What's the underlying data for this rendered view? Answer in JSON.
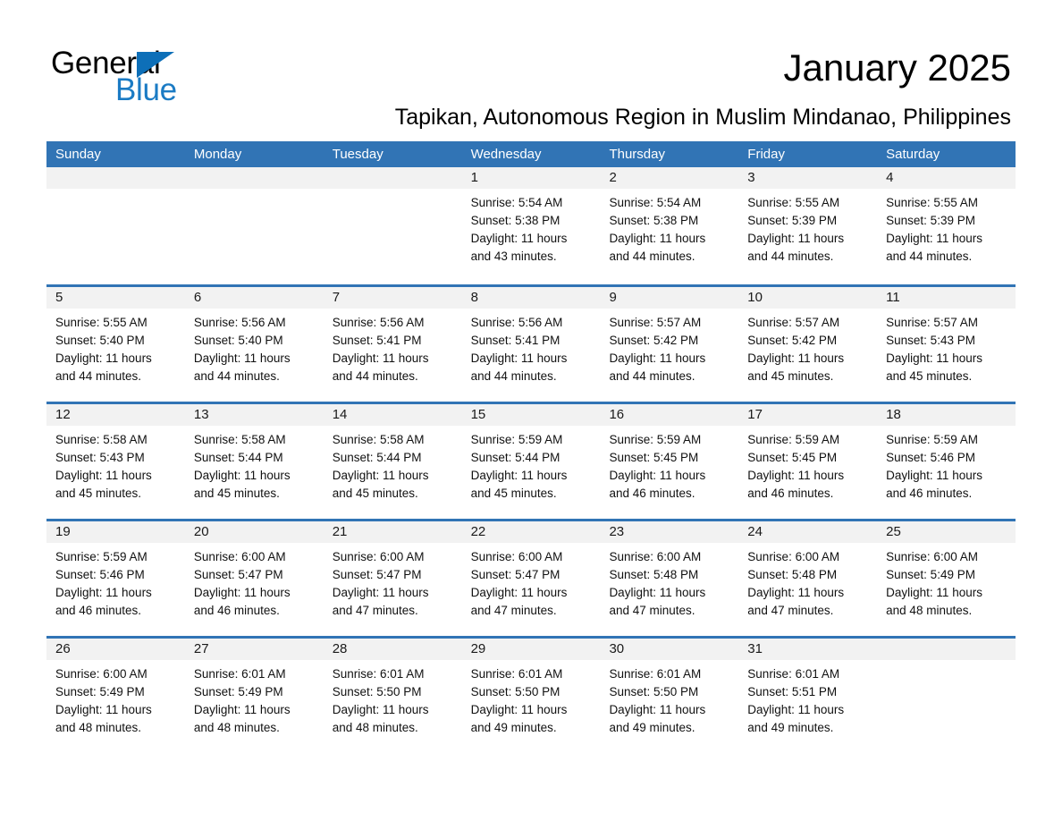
{
  "brand": {
    "name_top": "General",
    "name_bottom": "Blue",
    "triangle_color": "#0d6fb8",
    "blue_text_color": "#1b7bc4"
  },
  "header": {
    "month_title": "January 2025",
    "location": "Tapikan, Autonomous Region in Muslim Mindanao, Philippines",
    "header_bar_color": "#3174b5",
    "day_band_color": "#f2f2f2"
  },
  "weekdays": [
    "Sunday",
    "Monday",
    "Tuesday",
    "Wednesday",
    "Thursday",
    "Friday",
    "Saturday"
  ],
  "weeks": [
    [
      {
        "day": "",
        "sunrise": "",
        "sunset": "",
        "daylight_line1": "",
        "daylight_line2": ""
      },
      {
        "day": "",
        "sunrise": "",
        "sunset": "",
        "daylight_line1": "",
        "daylight_line2": ""
      },
      {
        "day": "",
        "sunrise": "",
        "sunset": "",
        "daylight_line1": "",
        "daylight_line2": ""
      },
      {
        "day": "1",
        "sunrise": "Sunrise: 5:54 AM",
        "sunset": "Sunset: 5:38 PM",
        "daylight_line1": "Daylight: 11 hours",
        "daylight_line2": "and 43 minutes."
      },
      {
        "day": "2",
        "sunrise": "Sunrise: 5:54 AM",
        "sunset": "Sunset: 5:38 PM",
        "daylight_line1": "Daylight: 11 hours",
        "daylight_line2": "and 44 minutes."
      },
      {
        "day": "3",
        "sunrise": "Sunrise: 5:55 AM",
        "sunset": "Sunset: 5:39 PM",
        "daylight_line1": "Daylight: 11 hours",
        "daylight_line2": "and 44 minutes."
      },
      {
        "day": "4",
        "sunrise": "Sunrise: 5:55 AM",
        "sunset": "Sunset: 5:39 PM",
        "daylight_line1": "Daylight: 11 hours",
        "daylight_line2": "and 44 minutes."
      }
    ],
    [
      {
        "day": "5",
        "sunrise": "Sunrise: 5:55 AM",
        "sunset": "Sunset: 5:40 PM",
        "daylight_line1": "Daylight: 11 hours",
        "daylight_line2": "and 44 minutes."
      },
      {
        "day": "6",
        "sunrise": "Sunrise: 5:56 AM",
        "sunset": "Sunset: 5:40 PM",
        "daylight_line1": "Daylight: 11 hours",
        "daylight_line2": "and 44 minutes."
      },
      {
        "day": "7",
        "sunrise": "Sunrise: 5:56 AM",
        "sunset": "Sunset: 5:41 PM",
        "daylight_line1": "Daylight: 11 hours",
        "daylight_line2": "and 44 minutes."
      },
      {
        "day": "8",
        "sunrise": "Sunrise: 5:56 AM",
        "sunset": "Sunset: 5:41 PM",
        "daylight_line1": "Daylight: 11 hours",
        "daylight_line2": "and 44 minutes."
      },
      {
        "day": "9",
        "sunrise": "Sunrise: 5:57 AM",
        "sunset": "Sunset: 5:42 PM",
        "daylight_line1": "Daylight: 11 hours",
        "daylight_line2": "and 44 minutes."
      },
      {
        "day": "10",
        "sunrise": "Sunrise: 5:57 AM",
        "sunset": "Sunset: 5:42 PM",
        "daylight_line1": "Daylight: 11 hours",
        "daylight_line2": "and 45 minutes."
      },
      {
        "day": "11",
        "sunrise": "Sunrise: 5:57 AM",
        "sunset": "Sunset: 5:43 PM",
        "daylight_line1": "Daylight: 11 hours",
        "daylight_line2": "and 45 minutes."
      }
    ],
    [
      {
        "day": "12",
        "sunrise": "Sunrise: 5:58 AM",
        "sunset": "Sunset: 5:43 PM",
        "daylight_line1": "Daylight: 11 hours",
        "daylight_line2": "and 45 minutes."
      },
      {
        "day": "13",
        "sunrise": "Sunrise: 5:58 AM",
        "sunset": "Sunset: 5:44 PM",
        "daylight_line1": "Daylight: 11 hours",
        "daylight_line2": "and 45 minutes."
      },
      {
        "day": "14",
        "sunrise": "Sunrise: 5:58 AM",
        "sunset": "Sunset: 5:44 PM",
        "daylight_line1": "Daylight: 11 hours",
        "daylight_line2": "and 45 minutes."
      },
      {
        "day": "15",
        "sunrise": "Sunrise: 5:59 AM",
        "sunset": "Sunset: 5:44 PM",
        "daylight_line1": "Daylight: 11 hours",
        "daylight_line2": "and 45 minutes."
      },
      {
        "day": "16",
        "sunrise": "Sunrise: 5:59 AM",
        "sunset": "Sunset: 5:45 PM",
        "daylight_line1": "Daylight: 11 hours",
        "daylight_line2": "and 46 minutes."
      },
      {
        "day": "17",
        "sunrise": "Sunrise: 5:59 AM",
        "sunset": "Sunset: 5:45 PM",
        "daylight_line1": "Daylight: 11 hours",
        "daylight_line2": "and 46 minutes."
      },
      {
        "day": "18",
        "sunrise": "Sunrise: 5:59 AM",
        "sunset": "Sunset: 5:46 PM",
        "daylight_line1": "Daylight: 11 hours",
        "daylight_line2": "and 46 minutes."
      }
    ],
    [
      {
        "day": "19",
        "sunrise": "Sunrise: 5:59 AM",
        "sunset": "Sunset: 5:46 PM",
        "daylight_line1": "Daylight: 11 hours",
        "daylight_line2": "and 46 minutes."
      },
      {
        "day": "20",
        "sunrise": "Sunrise: 6:00 AM",
        "sunset": "Sunset: 5:47 PM",
        "daylight_line1": "Daylight: 11 hours",
        "daylight_line2": "and 46 minutes."
      },
      {
        "day": "21",
        "sunrise": "Sunrise: 6:00 AM",
        "sunset": "Sunset: 5:47 PM",
        "daylight_line1": "Daylight: 11 hours",
        "daylight_line2": "and 47 minutes."
      },
      {
        "day": "22",
        "sunrise": "Sunrise: 6:00 AM",
        "sunset": "Sunset: 5:47 PM",
        "daylight_line1": "Daylight: 11 hours",
        "daylight_line2": "and 47 minutes."
      },
      {
        "day": "23",
        "sunrise": "Sunrise: 6:00 AM",
        "sunset": "Sunset: 5:48 PM",
        "daylight_line1": "Daylight: 11 hours",
        "daylight_line2": "and 47 minutes."
      },
      {
        "day": "24",
        "sunrise": "Sunrise: 6:00 AM",
        "sunset": "Sunset: 5:48 PM",
        "daylight_line1": "Daylight: 11 hours",
        "daylight_line2": "and 47 minutes."
      },
      {
        "day": "25",
        "sunrise": "Sunrise: 6:00 AM",
        "sunset": "Sunset: 5:49 PM",
        "daylight_line1": "Daylight: 11 hours",
        "daylight_line2": "and 48 minutes."
      }
    ],
    [
      {
        "day": "26",
        "sunrise": "Sunrise: 6:00 AM",
        "sunset": "Sunset: 5:49 PM",
        "daylight_line1": "Daylight: 11 hours",
        "daylight_line2": "and 48 minutes."
      },
      {
        "day": "27",
        "sunrise": "Sunrise: 6:01 AM",
        "sunset": "Sunset: 5:49 PM",
        "daylight_line1": "Daylight: 11 hours",
        "daylight_line2": "and 48 minutes."
      },
      {
        "day": "28",
        "sunrise": "Sunrise: 6:01 AM",
        "sunset": "Sunset: 5:50 PM",
        "daylight_line1": "Daylight: 11 hours",
        "daylight_line2": "and 48 minutes."
      },
      {
        "day": "29",
        "sunrise": "Sunrise: 6:01 AM",
        "sunset": "Sunset: 5:50 PM",
        "daylight_line1": "Daylight: 11 hours",
        "daylight_line2": "and 49 minutes."
      },
      {
        "day": "30",
        "sunrise": "Sunrise: 6:01 AM",
        "sunset": "Sunset: 5:50 PM",
        "daylight_line1": "Daylight: 11 hours",
        "daylight_line2": "and 49 minutes."
      },
      {
        "day": "31",
        "sunrise": "Sunrise: 6:01 AM",
        "sunset": "Sunset: 5:51 PM",
        "daylight_line1": "Daylight: 11 hours",
        "daylight_line2": "and 49 minutes."
      },
      {
        "day": "",
        "sunrise": "",
        "sunset": "",
        "daylight_line1": "",
        "daylight_line2": ""
      }
    ]
  ]
}
